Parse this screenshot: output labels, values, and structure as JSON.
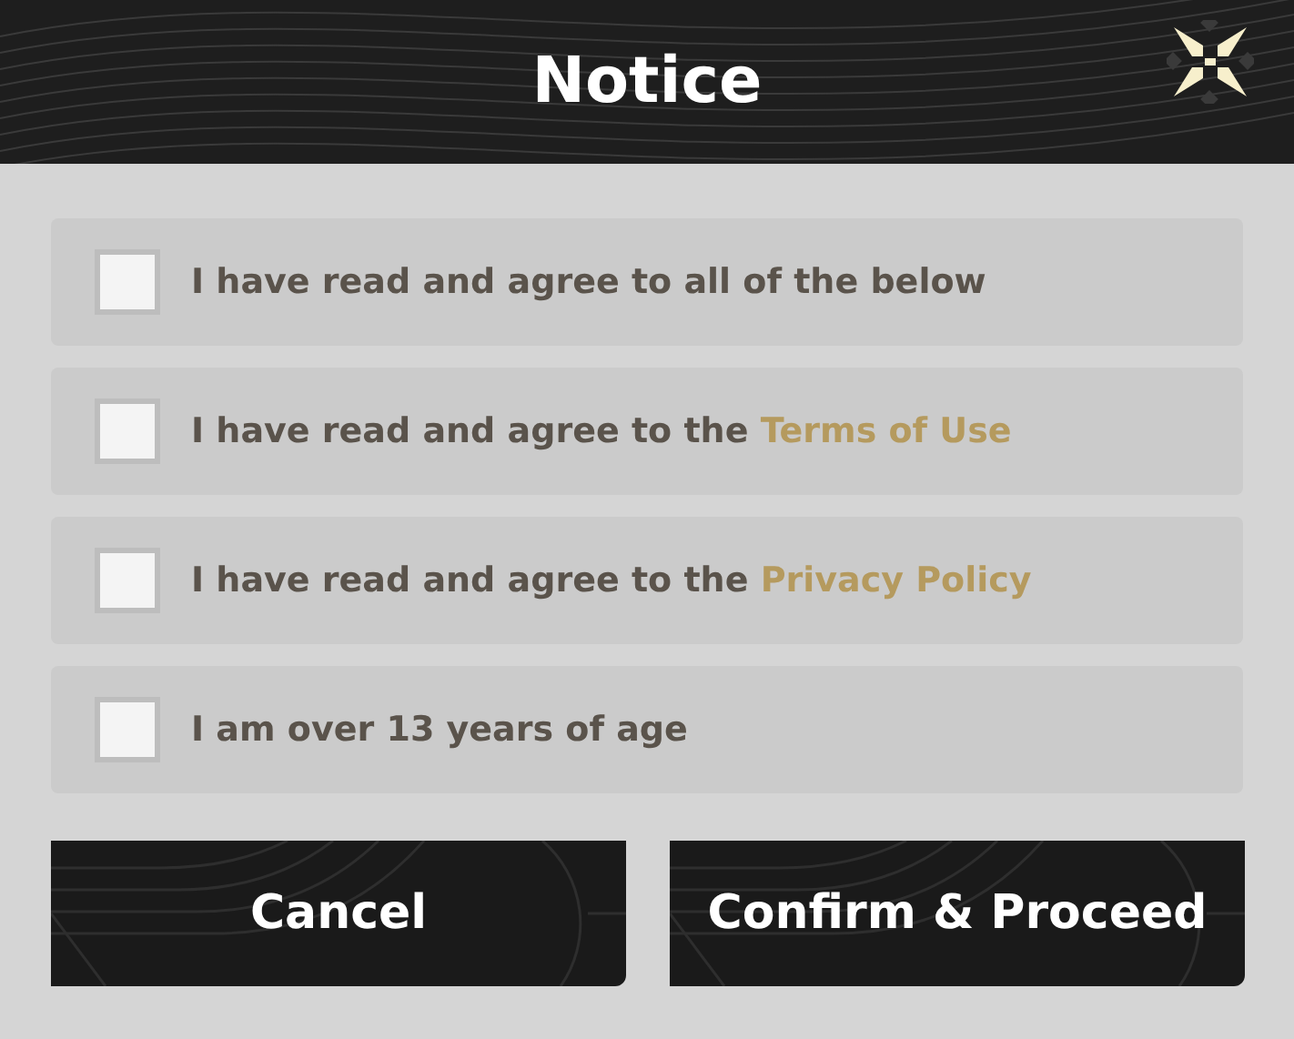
{
  "header": {
    "title": "Notice"
  },
  "agreements": [
    {
      "text": "I have read and agree to all of the below",
      "checked": false
    },
    {
      "text": "I have read and agree to the",
      "link": "Terms of Use",
      "checked": false
    },
    {
      "text": "I have read and agree to the",
      "link": "Privacy Policy",
      "checked": false
    },
    {
      "text": "I am over 13 years of age",
      "checked": false
    }
  ],
  "buttons": [
    {
      "label": "Cancel"
    },
    {
      "label": "Confirm & Proceed"
    }
  ]
}
